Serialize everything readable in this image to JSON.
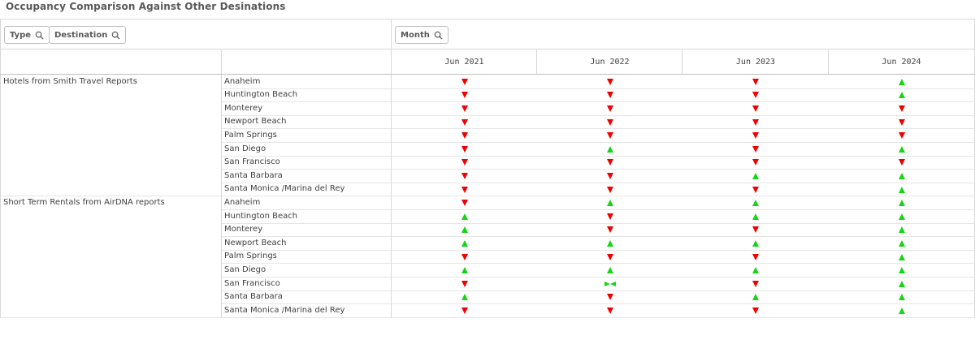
{
  "title": "Occupancy Comparison Against Other Desinations",
  "filters": {
    "type_label": "Type",
    "destination_label": "Destination",
    "month_label": "Month"
  },
  "months": [
    "Jun 2021",
    "Jun 2022",
    "Jun 2023",
    "Jun 2024"
  ],
  "groups": [
    {
      "label": "Hotels from Smith Travel Reports",
      "rows": [
        {
          "destination": "Anaheim",
          "trends": [
            "down",
            "down",
            "down",
            "up"
          ]
        },
        {
          "destination": "Huntington Beach",
          "trends": [
            "down",
            "down",
            "down",
            "up"
          ]
        },
        {
          "destination": "Monterey",
          "trends": [
            "down",
            "down",
            "down",
            "down"
          ]
        },
        {
          "destination": "Newport Beach",
          "trends": [
            "down",
            "down",
            "down",
            "down"
          ]
        },
        {
          "destination": "Palm Springs",
          "trends": [
            "down",
            "down",
            "down",
            "down"
          ]
        },
        {
          "destination": "San Diego",
          "trends": [
            "down",
            "up",
            "down",
            "up"
          ]
        },
        {
          "destination": "San Francisco",
          "trends": [
            "down",
            "down",
            "down",
            "down"
          ]
        },
        {
          "destination": "Santa Barbara",
          "trends": [
            "down",
            "down",
            "up",
            "up"
          ]
        },
        {
          "destination": "Santa Monica /Marina del Rey",
          "trends": [
            "down",
            "down",
            "down",
            "up"
          ]
        }
      ]
    },
    {
      "label": "Short Term Rentals from AirDNA reports",
      "rows": [
        {
          "destination": "Anaheim",
          "trends": [
            "down",
            "up",
            "up",
            "up"
          ]
        },
        {
          "destination": "Huntington Beach",
          "trends": [
            "up",
            "down",
            "up",
            "up"
          ]
        },
        {
          "destination": "Monterey",
          "trends": [
            "up",
            "down",
            "down",
            "up"
          ]
        },
        {
          "destination": "Newport Beach",
          "trends": [
            "up",
            "up",
            "up",
            "up"
          ]
        },
        {
          "destination": "Palm Springs",
          "trends": [
            "down",
            "down",
            "down",
            "up"
          ]
        },
        {
          "destination": "San Diego",
          "trends": [
            "up",
            "up",
            "up",
            "up"
          ]
        },
        {
          "destination": "San Francisco",
          "trends": [
            "down",
            "flat",
            "down",
            "up"
          ]
        },
        {
          "destination": "Santa Barbara",
          "trends": [
            "up",
            "down",
            "up",
            "up"
          ]
        },
        {
          "destination": "Santa Monica /Marina del Rey",
          "trends": [
            "down",
            "down",
            "down",
            "up"
          ]
        }
      ]
    }
  ],
  "colors": {
    "up": "#15d515",
    "down": "#f00000",
    "grid": "#d9d9d9",
    "text": "#404040"
  },
  "icons": {
    "up": "triangle-up-icon",
    "down": "triangle-down-icon",
    "flat": "flat-trend-icon",
    "search": "search-icon"
  }
}
